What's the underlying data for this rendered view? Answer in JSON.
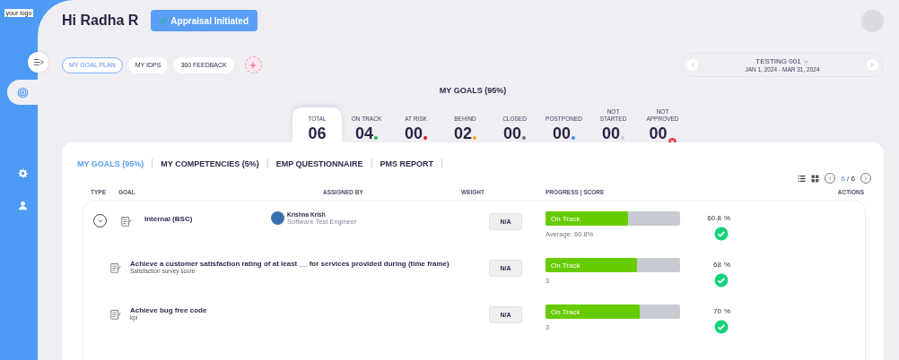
{
  "sidebar": {
    "logo": "your logo",
    "items": [
      {
        "kind": "goals",
        "selected": true
      },
      {
        "kind": "settings",
        "selected": false
      },
      {
        "kind": "user",
        "selected": false
      }
    ]
  },
  "header": {
    "greeting": "Hi Radha R",
    "status_button": "Appraisal Initiated"
  },
  "plan_tabs": [
    {
      "label": "MY GOAL PLAN",
      "selected": true
    },
    {
      "label": "MY IDPS",
      "selected": false
    },
    {
      "label": "360 FEEDBACK",
      "selected": false
    }
  ],
  "period": {
    "name": "TESTING 001",
    "range": "JAN 1, 2024 - MAR 31, 2024"
  },
  "title": "MY GOALS (95%)",
  "stats": [
    {
      "label": "TOTAL",
      "value": "06",
      "selected": true,
      "kind": "plain"
    },
    {
      "label": "ON TRACK",
      "value": "04",
      "selected": false,
      "kind": "dot",
      "color": "#1bb55c"
    },
    {
      "label": "AT RISK",
      "value": "00",
      "selected": false,
      "kind": "dot",
      "color": "#e8121e"
    },
    {
      "label": "BEHIND",
      "value": "02",
      "selected": false,
      "kind": "dot",
      "color": "#f5a31a"
    },
    {
      "label": "CLOSED",
      "value": "00",
      "selected": false,
      "kind": "dot",
      "color": "#6b6b73"
    },
    {
      "label": "POSTPONED",
      "value": "00",
      "selected": false,
      "kind": "dot",
      "color": "#3d8ef0"
    },
    {
      "label": "NOT STARTED",
      "value": "00",
      "selected": false,
      "kind": "dot",
      "color": "#c9c9cf"
    },
    {
      "label": "NOT APPROVED",
      "value": "00",
      "selected": false,
      "kind": "badge",
      "color": "#e0404f"
    }
  ],
  "goal_tabs": [
    {
      "label": "MY GOALS (95%)",
      "selected": true
    },
    {
      "label": "MY COMPETENCIES (5%)",
      "selected": false
    },
    {
      "label": "EMP QUESTIONNAIRE",
      "selected": false
    },
    {
      "label": "PMS REPORT",
      "selected": false
    }
  ],
  "views": [
    {
      "kind": "list",
      "selected": true
    },
    {
      "kind": "grid",
      "selected": false
    }
  ],
  "pager": {
    "current": "6",
    "total": "/ 6"
  },
  "columns": [
    "TYPE",
    "GOAL",
    "ASSIGNED BY",
    "WEIGHT",
    "PROGRESS | SCORE",
    "ACTIONS"
  ],
  "groups": [
    {
      "title": "Internal (BSC)",
      "expanded": true,
      "assignee": {
        "name": "Krishna Krish",
        "role": "Software Test Engineer"
      },
      "weight": "N/A",
      "status": "On Track",
      "level": 0.61,
      "note": "Average: 60.8%",
      "score": "60.8",
      "unit": "%",
      "done": true,
      "children": [
        {
          "title": "Achieve a customer satisfaction rating of at least __ for services provided during (time frame)",
          "subtitle": "Satisfaction survey score",
          "weight": "N/A",
          "status": "On Track",
          "level": 0.68,
          "note": "3",
          "score": "68",
          "unit": "%",
          "done": true
        },
        {
          "title": "Achieve bug free code",
          "subtitle": "kpi",
          "weight": "N/A",
          "status": "On Track",
          "level": 0.7,
          "note": "3",
          "score": "70",
          "unit": "%",
          "done": true
        }
      ]
    }
  ]
}
